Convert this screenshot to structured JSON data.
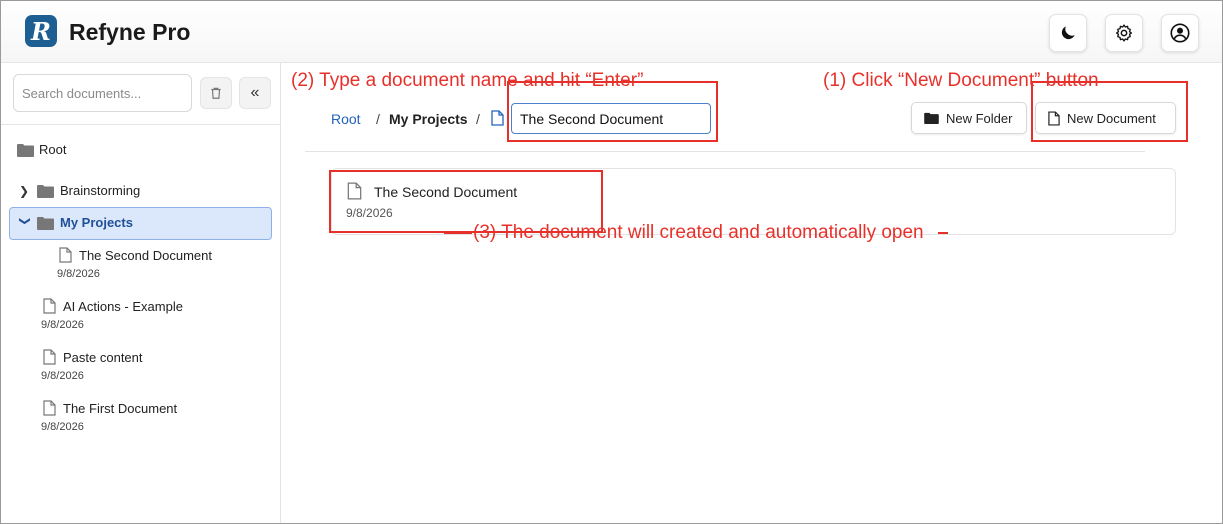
{
  "header": {
    "logo_letter": "R",
    "app_title": "Refyne Pro"
  },
  "sidebar": {
    "search_placeholder": "Search documents...",
    "root_label": "Root",
    "items": [
      {
        "type": "folder",
        "label": "Brainstorming"
      },
      {
        "type": "folder",
        "label": "My Projects",
        "selected": true
      },
      {
        "type": "document",
        "label": "The Second Document",
        "date": "9/8/2026"
      },
      {
        "type": "document",
        "label": "AI Actions - Example",
        "date": "9/8/2026"
      },
      {
        "type": "document",
        "label": "Paste content",
        "date": "9/8/2026"
      },
      {
        "type": "document",
        "label": "The First Document",
        "date": "9/8/2026"
      }
    ]
  },
  "breadcrumb": {
    "root": "Root",
    "separator": "/",
    "current": "My Projects",
    "new_doc_name_value": "The Second Document"
  },
  "toolbar": {
    "new_folder_label": "New Folder",
    "new_document_label": "New Document"
  },
  "document_card": {
    "title": "The Second Document",
    "date": "9/8/2026"
  },
  "annotations": {
    "step1": "(1) Click “New Document” button",
    "step2": "(2) Type a document name and hit “Enter”",
    "step3": "(3) The document will created and automatically open"
  },
  "colors": {
    "brand": "#1d5f93",
    "accent_link": "#2563b8",
    "selected_bg": "#dbe8fb",
    "annotation": "#e8302a"
  }
}
